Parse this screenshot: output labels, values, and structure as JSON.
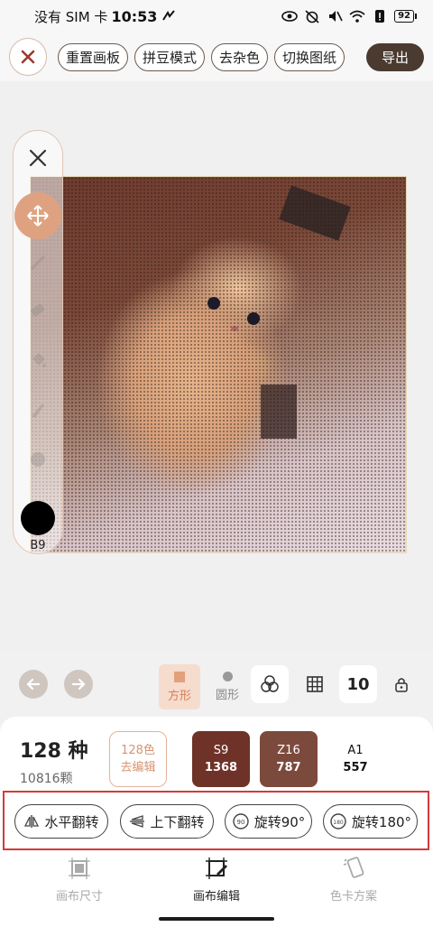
{
  "status_bar": {
    "carrier": "没有 SIM 卡",
    "time": "10:53",
    "battery": "92"
  },
  "toolbar": {
    "reset_label": "重置画板",
    "bead_mode_label": "拼豆模式",
    "denoise_label": "去杂色",
    "switch_pattern_label": "切换图纸",
    "export_label": "导出"
  },
  "side_panel": {
    "current_color_code": "B9",
    "current_color": "#000000"
  },
  "controls": {
    "shape_square_label": "方形",
    "shape_round_label": "圆形",
    "zoom_value": "10"
  },
  "summary": {
    "color_count": "128 种",
    "bead_count": "10816颗",
    "edit_button_line1": "128色",
    "edit_button_line2": "去编辑"
  },
  "swatches": [
    {
      "code": "S9",
      "qty": "1368",
      "color": "#6e3228",
      "text_color": "#ffffff"
    },
    {
      "code": "Z16",
      "qty": "787",
      "color": "#7c4a3c",
      "text_color": "#ffffff"
    },
    {
      "code": "A1",
      "qty": "557",
      "color": "#ffffff",
      "text_color": "#111111"
    }
  ],
  "actions": {
    "flip_horizontal": "水平翻转",
    "flip_vertical": "上下翻转",
    "rotate_90": "旋转90°",
    "rotate_180": "旋转180°"
  },
  "bottom_nav": {
    "canvas_size": "画布尺寸",
    "canvas_edit": "画布编辑",
    "color_card": "色卡方案"
  }
}
